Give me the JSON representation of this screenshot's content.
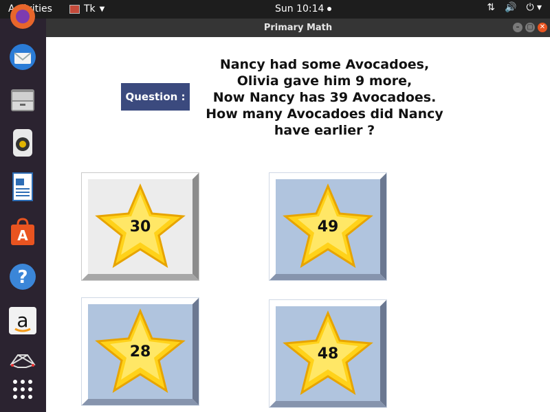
{
  "topbar": {
    "activities": "Activities",
    "app_name": "Tk",
    "clock": "Sun 10:14"
  },
  "window": {
    "title": "Primary Math"
  },
  "question": {
    "label": "Question :",
    "lines": [
      "Nancy had some Avocadoes,",
      "Olivia gave him 9 more,",
      "Now Nancy has 39 Avocadoes.",
      "How many Avocadoes did Nancy",
      "have earlier ?"
    ]
  },
  "answers": [
    {
      "value": "30",
      "state": "selected"
    },
    {
      "value": "49",
      "state": "normal"
    },
    {
      "value": "28",
      "state": "normal"
    },
    {
      "value": "48",
      "state": "normal"
    }
  ],
  "colors": {
    "question_label_bg": "#3b4a7e",
    "tile_face": "#b0c4de",
    "tile_face_selected": "#ececec",
    "star_fill": "#ffd21a",
    "topbar_bg": "#1d1d1d",
    "dock_bg": "#2b2330"
  },
  "dock_icons": [
    "thunderbird-icon",
    "files-icon",
    "rhythmbox-icon",
    "writer-icon",
    "software-icon",
    "help-icon",
    "amazon-icon",
    "network-icon",
    "app-grid-icon"
  ]
}
